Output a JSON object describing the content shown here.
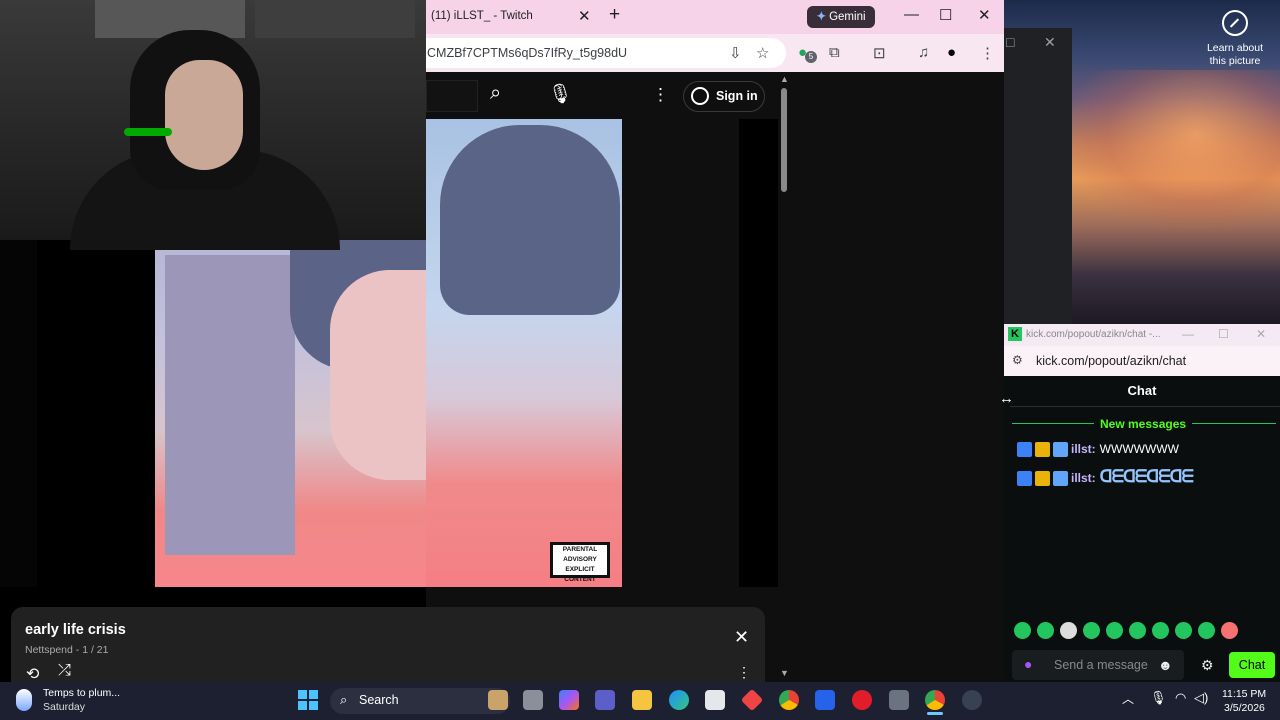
{
  "desktop": {
    "lens_label": "Learn about this picture"
  },
  "chrome": {
    "tab_title": "(11) iLLST_ - Twitch",
    "gemini_label": "Gemini",
    "url": "CMZBf7CPTMs6qDs7IfRy_t5g98dU",
    "extension_badge": "5"
  },
  "youtube": {
    "sign_in_label": "Sign in"
  },
  "now_playing": {
    "title": "early life crisis",
    "subtitle": "Nettspend - 1 / 21"
  },
  "album": {
    "advisory_text": "PARENTAL ADVISORY EXPLICIT CONTENT"
  },
  "kick": {
    "window_title": "kick.com/popout/azikn/chat -...",
    "url": "kick.com/popout/azikn/chat",
    "header": "Chat",
    "new_messages_label": "New messages",
    "messages": [
      {
        "user": "illst:",
        "text": "WWWWWWW"
      },
      {
        "user": "illst:",
        "text": "ᗡᗴᗡᗴᗡᗴᗡᗴ"
      }
    ],
    "input_placeholder": "Send a message",
    "send_label": "Chat"
  },
  "taskbar": {
    "weather_line1": "Temps to plum...",
    "weather_line2": "Saturday",
    "search_label": "Search",
    "time": "11:15 PM",
    "date": "3/5/2026"
  },
  "colors": {
    "kick_green": "#53fc18",
    "chrome_tab_pink": "#f6d3e8"
  }
}
